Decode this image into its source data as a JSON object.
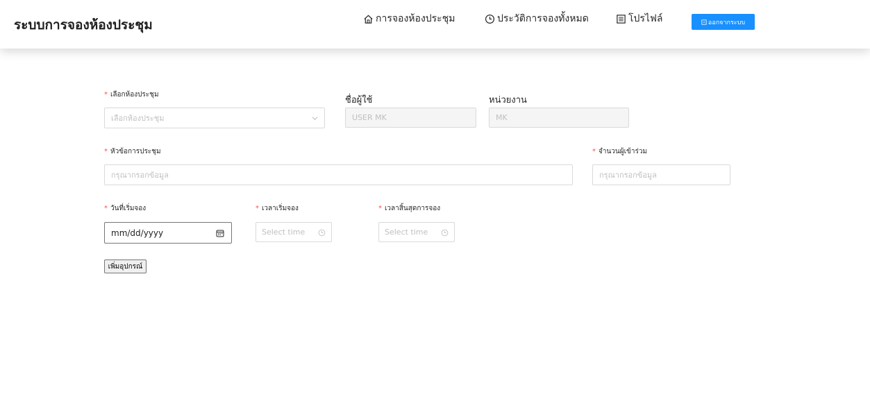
{
  "header": {
    "brand": "ระบบการจองห้องประชุม",
    "nav": {
      "home": "การจองห้องประชุม",
      "history": "ประวัติการจองทั้งหมด",
      "profile": "โปรไฟล์"
    },
    "logout_label": "ออกจากระบบ"
  },
  "form": {
    "room": {
      "label": "เลือกห้องประชุม",
      "placeholder": "เลือกห้องประชุม"
    },
    "username": {
      "label": "ชื่อผู้ใช้",
      "value": "USER MK"
    },
    "department": {
      "label": "หน่วยงาน",
      "value": "MK"
    },
    "topic": {
      "label": "หัวข้อการประชุม",
      "placeholder": "กรุณากรอกข้อมูล"
    },
    "attendees": {
      "label": "จำนวนผู้เข้าร่วม",
      "placeholder": "กรุณากรอกข้อมูล"
    },
    "start_date": {
      "label": "วันที่เริ่มจอง",
      "placeholder": "mm/dd/yyyy"
    },
    "start_time": {
      "label": "เวลาเริ่มจอง",
      "placeholder": "Select time"
    },
    "end_time": {
      "label": "เวลาสิ้นสุดการจอง",
      "placeholder": "Select time"
    },
    "add_equipment_label": "เพิ่มอุปกรณ์"
  },
  "colors": {
    "primary": "#1890ff",
    "required": "#ff4d4f",
    "border": "#d9d9d9",
    "placeholder": "#bfbfbf",
    "disabled_bg": "#f5f5f5"
  },
  "icons": {
    "home": "home-icon",
    "history": "clock-icon",
    "profile": "document-icon",
    "logout": "logout-icon",
    "select": "chevron-down-icon",
    "date": "calendar-icon",
    "time": "clock-icon"
  }
}
